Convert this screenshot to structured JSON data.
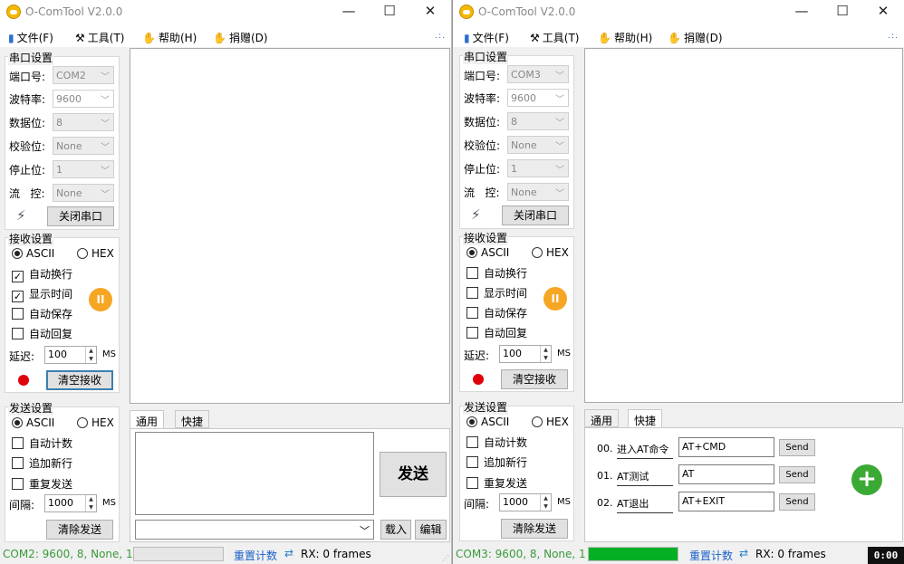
{
  "left": {
    "title": "O-ComTool V2.0.0",
    "menu": {
      "file": "文件(F)",
      "tools": "工具(T)",
      "help": "帮助(H)",
      "donate": "捐赠(D)"
    },
    "serial": {
      "title": "串口设置",
      "port_label": "端口号:",
      "port": "COM2",
      "baud_label": "波特率:",
      "baud": "9600",
      "data_label": "数据位:",
      "databits": "8",
      "parity_label": "校验位:",
      "parity": "None",
      "stop_label": "停止位:",
      "stopbits": "1",
      "flow_label": "流   控:",
      "flow": "None",
      "open_btn": "关闭串口"
    },
    "recv": {
      "title": "接收设置",
      "ascii": "ASCII",
      "hex": "HEX",
      "opt1": "自动换行",
      "opt2": "显示时间",
      "opt3": "自动保存",
      "opt4": "自动回复",
      "delay_label": "延迟:",
      "delay": "100",
      "unit": "MS",
      "pause": "II",
      "clear_btn": "清空接收"
    },
    "send": {
      "title": "发送设置",
      "ascii": "ASCII",
      "hex": "HEX",
      "opt1": "自动计数",
      "opt2": "追加新行",
      "opt3": "重复发送",
      "interval_label": "间隔:",
      "interval": "1000",
      "unit": "MS",
      "clear_btn": "清除发送"
    },
    "tabs": {
      "general": "通用",
      "quick": "快捷"
    },
    "send_btn": "发送",
    "load_btn": "载入",
    "edit_btn": "编辑",
    "status": {
      "port": "COM2: 9600, 8, None, 1",
      "progress": 0,
      "reset": "重置计数",
      "rx": "RX: 0 frames"
    }
  },
  "right": {
    "title": "O-ComTool V2.0.0",
    "menu": {
      "file": "文件(F)",
      "tools": "工具(T)",
      "help": "帮助(H)",
      "donate": "捐赠(D)"
    },
    "serial": {
      "title": "串口设置",
      "port_label": "端口号:",
      "port": "COM3",
      "baud_label": "波特率:",
      "baud": "9600",
      "data_label": "数据位:",
      "databits": "8",
      "parity_label": "校验位:",
      "parity": "None",
      "stop_label": "停止位:",
      "stopbits": "1",
      "flow_label": "流   控:",
      "flow": "None",
      "open_btn": "关闭串口"
    },
    "recv": {
      "title": "接收设置",
      "ascii": "ASCII",
      "hex": "HEX",
      "opt1": "自动换行",
      "opt2": "显示时间",
      "opt3": "自动保存",
      "opt4": "自动回复",
      "delay_label": "延迟:",
      "delay": "100",
      "unit": "MS",
      "pause": "II",
      "clear_btn": "清空接收"
    },
    "send": {
      "title": "发送设置",
      "ascii": "ASCII",
      "hex": "HEX",
      "opt1": "自动计数",
      "opt2": "追加新行",
      "opt3": "重复发送",
      "interval_label": "间隔:",
      "interval": "1000",
      "unit": "MS",
      "clear_btn": "清除发送"
    },
    "tabs": {
      "general": "通用",
      "quick": "快捷"
    },
    "quick": [
      {
        "num": "00.",
        "label": "进入AT命令",
        "cmd": "AT+CMD",
        "send": "Send"
      },
      {
        "num": "01.",
        "label": "AT测试",
        "cmd": "AT",
        "send": "Send"
      },
      {
        "num": "02.",
        "label": "AT退出",
        "cmd": "AT+EXIT",
        "send": "Send"
      }
    ],
    "status": {
      "port": "COM3: 9600, 8, None, 1",
      "progress": 1,
      "reset": "重置计数",
      "rx": "RX: 0 frames"
    }
  },
  "timer": "0:00",
  "colors": {
    "pause": "#f5a623",
    "record": "#e0000a",
    "progress": "#06b025",
    "status_port": "#3a9a3a",
    "add": "#3aaa35"
  }
}
